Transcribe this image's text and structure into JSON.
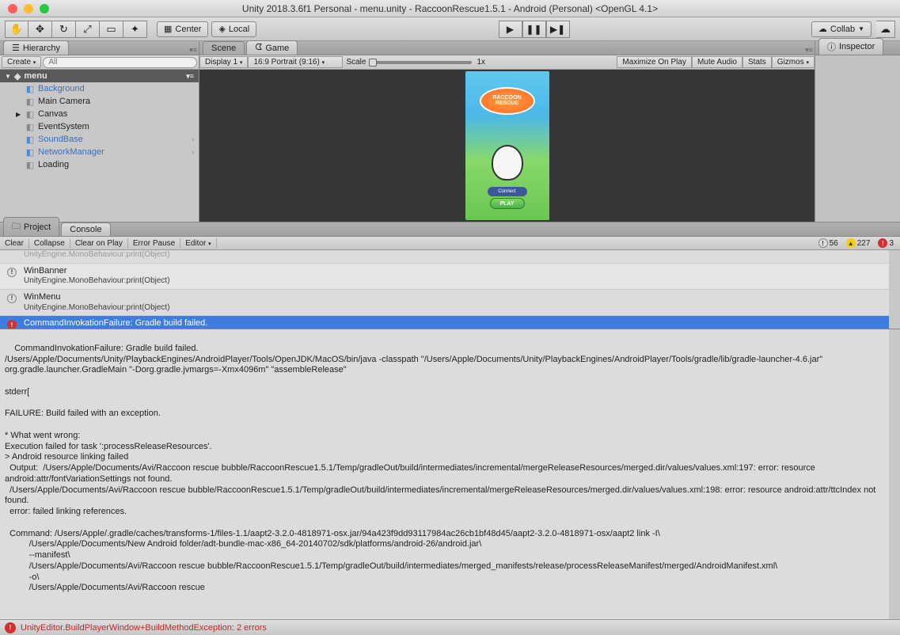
{
  "titlebar": {
    "title": "Unity 2018.3.6f1 Personal - menu.unity - RaccoonRescue1.5.1 - Android (Personal) <OpenGL 4.1>"
  },
  "toolbar": {
    "center": "Center",
    "local": "Local",
    "collab": "Collab"
  },
  "hierarchy": {
    "tab": "Hierarchy",
    "create": "Create",
    "search_placeholder": "All",
    "scene": "menu",
    "items": [
      {
        "label": "Background",
        "blue": true,
        "cube": "blue"
      },
      {
        "label": "Main Camera",
        "blue": false,
        "cube": "gray"
      },
      {
        "label": "Canvas",
        "blue": false,
        "cube": "gray",
        "arrow": true
      },
      {
        "label": "EventSystem",
        "blue": false,
        "cube": "gray"
      },
      {
        "label": "SoundBase",
        "blue": true,
        "cube": "blue",
        "chev": true
      },
      {
        "label": "NetworkManager",
        "blue": true,
        "cube": "blue",
        "chev": true
      },
      {
        "label": "Loading",
        "blue": false,
        "cube": "gray"
      }
    ]
  },
  "gamePanel": {
    "sceneTab": "Scene",
    "gameTab": "Game",
    "display": "Display 1",
    "aspect": "16:9 Portrait (9:16)",
    "scale": "Scale",
    "scaleVal": "1x",
    "maximize": "Maximize On Play",
    "mute": "Mute Audio",
    "stats": "Stats",
    "gizmos": "Gizmos",
    "logo": "RACCOON RESCUE",
    "fbBtn": "Connect",
    "playBtn": "PLAY"
  },
  "inspector": {
    "tab": "Inspector"
  },
  "console": {
    "projectTab": "Project",
    "consoleTab": "Console",
    "clear": "Clear",
    "collapse": "Collapse",
    "clearOnPlay": "Clear on Play",
    "errorPause": "Error Pause",
    "editor": "Editor",
    "infoCount": "56",
    "warnCount": "227",
    "errCount": "3",
    "entries": [
      {
        "icon": "info",
        "line1": "WinBanner",
        "line2": "UnityEngine.MonoBehaviour:print(Object)"
      },
      {
        "icon": "info",
        "line1": "WinMenu",
        "line2": "UnityEngine.MonoBehaviour:print(Object)"
      },
      {
        "icon": "err",
        "line1": "CommandInvokationFailure: Gradle build failed.",
        "line2": "/Users/Apple/Documents/Unity/PlaybackEngines/AndroidPlayer/Tools/OpenJDK/MacOS/bin/java -classpath \"/Users/Apple/Documents/Unity/PlaybackEngines/AndroidPlayer/Too",
        "selected": true
      }
    ],
    "detail": "CommandInvokationFailure: Gradle build failed.\n/Users/Apple/Documents/Unity/PlaybackEngines/AndroidPlayer/Tools/OpenJDK/MacOS/bin/java -classpath \"/Users/Apple/Documents/Unity/PlaybackEngines/AndroidPlayer/Tools/gradle/lib/gradle-launcher-4.6.jar\" org.gradle.launcher.GradleMain \"-Dorg.gradle.jvmargs=-Xmx4096m\" \"assembleRelease\"\n\nstderr[\n\nFAILURE: Build failed with an exception.\n\n* What went wrong:\nExecution failed for task ':processReleaseResources'.\n> Android resource linking failed\n  Output:  /Users/Apple/Documents/Avi/Raccoon rescue bubble/RaccoonRescue1.5.1/Temp/gradleOut/build/intermediates/incremental/mergeReleaseResources/merged.dir/values/values.xml:197: error: resource android:attr/fontVariationSettings not found.\n  /Users/Apple/Documents/Avi/Raccoon rescue bubble/RaccoonRescue1.5.1/Temp/gradleOut/build/intermediates/incremental/mergeReleaseResources/merged.dir/values/values.xml:198: error: resource android:attr/ttcIndex not found.\n  error: failed linking references.\n\n  Command: /Users/Apple/.gradle/caches/transforms-1/files-1.1/aapt2-3.2.0-4818971-osx.jar/94a423f9dd93117984ac26cb1bf48d45/aapt2-3.2.0-4818971-osx/aapt2 link -I\\\n          /Users/Apple/Documents/New Android folder/adt-bundle-mac-x86_64-20140702/sdk/platforms/android-26/android.jar\\\n          --manifest\\\n          /Users/Apple/Documents/Avi/Raccoon rescue bubble/RaccoonRescue1.5.1/Temp/gradleOut/build/intermediates/merged_manifests/release/processReleaseManifest/merged/AndroidManifest.xml\\\n          -o\\\n          /Users/Apple/Documents/Avi/Raccoon rescue"
  },
  "statusbar": {
    "text": "UnityEditor.BuildPlayerWindow+BuildMethodException: 2 errors"
  }
}
